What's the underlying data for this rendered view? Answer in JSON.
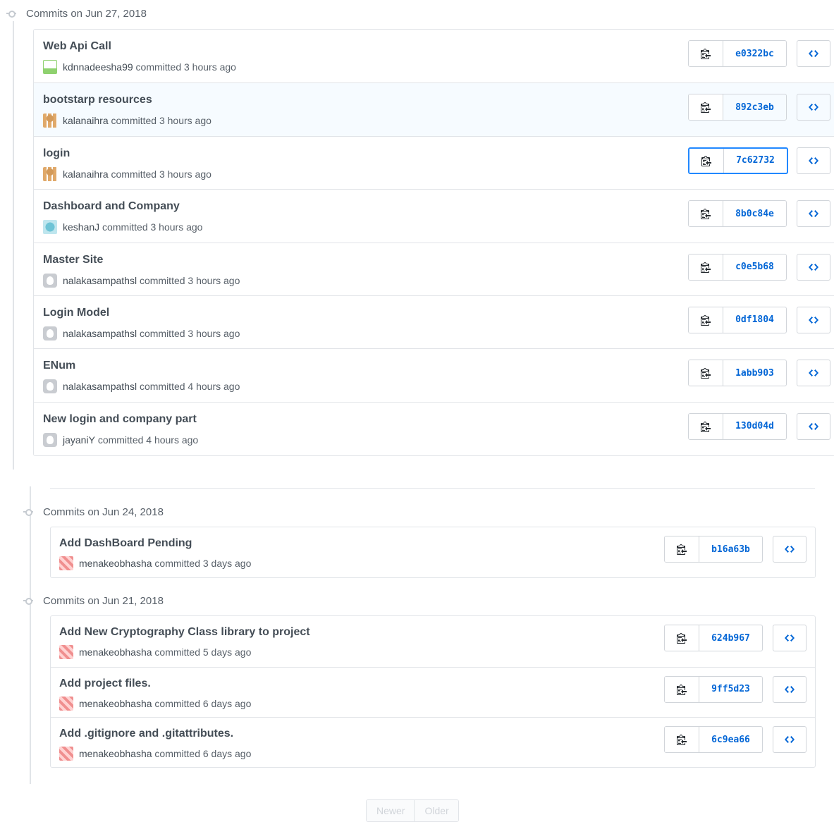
{
  "groups": [
    {
      "heading": "Commits on Jun 27, 2018",
      "commits": [
        {
          "message": "Web Api Call",
          "author": "kdnnadeesha99",
          "when": "committed 3 hours ago",
          "sha": "e0322bc",
          "avatar": "green"
        },
        {
          "message": "bootstarp resources",
          "author": "kalanaihra",
          "when": "committed 3 hours ago",
          "sha": "892c3eb",
          "avatar": "orange",
          "highlighted": true
        },
        {
          "message": "login",
          "author": "kalanaihra",
          "when": "committed 3 hours ago",
          "sha": "7c62732",
          "avatar": "orange",
          "focused": true
        },
        {
          "message": "Dashboard and Company",
          "author": "keshanJ",
          "when": "committed 3 hours ago",
          "sha": "8b0c84e",
          "avatar": "teal"
        },
        {
          "message": "Master Site",
          "author": "nalakasampathsl",
          "when": "committed 3 hours ago",
          "sha": "c0e5b68",
          "avatar": "gray"
        },
        {
          "message": "Login Model",
          "author": "nalakasampathsl",
          "when": "committed 3 hours ago",
          "sha": "0df1804",
          "avatar": "gray"
        },
        {
          "message": "ENum",
          "author": "nalakasampathsl",
          "when": "committed 4 hours ago",
          "sha": "1abb903",
          "avatar": "gray"
        },
        {
          "message": "New login and company part",
          "author": "jayaniY",
          "when": "committed 4 hours ago",
          "sha": "130d04d",
          "avatar": "gray"
        }
      ]
    },
    {
      "heading": "Commits on Jun 24, 2018",
      "commits": [
        {
          "message": "Add DashBoard Pending",
          "author": "menakeobhasha",
          "when": "committed 3 days ago",
          "sha": "b16a63b",
          "avatar": "pink"
        }
      ]
    },
    {
      "heading": "Commits on Jun 21, 2018",
      "commits": [
        {
          "message": "Add New Cryptography Class library to project",
          "author": "menakeobhasha",
          "when": "committed 5 days ago",
          "sha": "624b967",
          "avatar": "pink"
        },
        {
          "message": "Add project files.",
          "author": "menakeobhasha",
          "when": "committed 6 days ago",
          "sha": "9ff5d23",
          "avatar": "pink"
        },
        {
          "message": "Add .gitignore and .gitattributes.",
          "author": "menakeobhasha",
          "when": "committed 6 days ago",
          "sha": "6c9ea66",
          "avatar": "pink"
        }
      ]
    }
  ],
  "pagination": {
    "newer": "Newer",
    "older": "Older"
  },
  "icons": {
    "copy": "clipboard-icon",
    "browse": "code-brackets-icon",
    "group": "commit-node-icon"
  },
  "colors": {
    "sha_link": "#0366d6",
    "focus_ring": "#2188ff",
    "highlight_row": "#f6fbff"
  }
}
